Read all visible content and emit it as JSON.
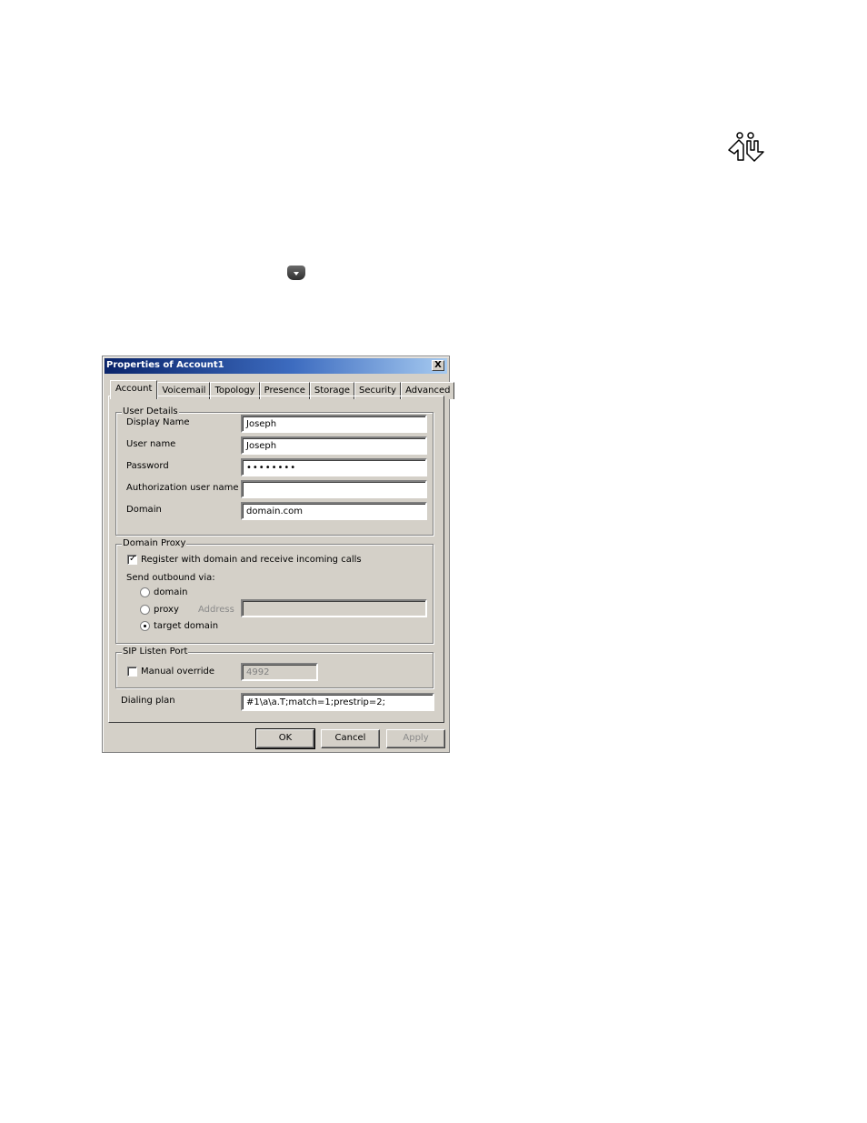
{
  "page": {
    "logo_icon": "people-arrow-logo-icon",
    "menu_button_icon": "dropdown-menu-icon"
  },
  "dialog": {
    "title": "Properties of Account1",
    "close_label": "X",
    "tabs": [
      {
        "label": "Account",
        "active": true
      },
      {
        "label": "Voicemail",
        "active": false
      },
      {
        "label": "Topology",
        "active": false
      },
      {
        "label": "Presence",
        "active": false
      },
      {
        "label": "Storage",
        "active": false
      },
      {
        "label": "Security",
        "active": false
      },
      {
        "label": "Advanced",
        "active": false
      }
    ],
    "user_details": {
      "legend": "User Details",
      "display_name_label": "Display Name",
      "display_name_value": "Joseph",
      "user_name_label": "User name",
      "user_name_value": "Joseph",
      "password_label": "Password",
      "password_value": "••••••••",
      "auth_user_label": "Authorization user name",
      "auth_user_value": "",
      "domain_label": "Domain",
      "domain_value": "domain.com"
    },
    "domain_proxy": {
      "legend": "Domain Proxy",
      "register_label": "Register with domain and receive incoming calls",
      "register_checked": true,
      "send_outbound_label": "Send outbound via:",
      "options": [
        {
          "label": "domain",
          "selected": false
        },
        {
          "label": "proxy",
          "selected": false
        },
        {
          "label": "target domain",
          "selected": true
        }
      ],
      "address_label": "Address",
      "address_value": ""
    },
    "sip_listen_port": {
      "legend": "SIP Listen Port",
      "manual_override_label": "Manual override",
      "manual_override_checked": false,
      "port_value": "4992"
    },
    "dialing_plan": {
      "label": "Dialing plan",
      "value": "#1\\a\\a.T;match=1;prestrip=2;"
    },
    "buttons": {
      "ok": "OK",
      "cancel": "Cancel",
      "apply": "Apply"
    }
  }
}
